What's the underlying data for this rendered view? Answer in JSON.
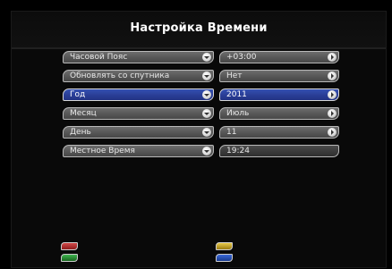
{
  "title": "Настройка Времени",
  "rows": [
    {
      "label": "Часовой Пояс",
      "value": "+03:00",
      "selected": false
    },
    {
      "label": "Обновлять со спутника",
      "value": "Нет",
      "selected": false
    },
    {
      "label": "Год",
      "value": "2011",
      "selected": true
    },
    {
      "label": "Месяц",
      "value": "Июль",
      "selected": false
    },
    {
      "label": "День",
      "value": "11",
      "selected": false
    },
    {
      "label": "Местное Время",
      "value": "19:24",
      "selected": false
    }
  ],
  "colors": {
    "selected": "#2a3e96",
    "background": "#090909"
  },
  "footer_buttons": [
    {
      "name": "red-button",
      "color": "red"
    },
    {
      "name": "green-button",
      "color": "green"
    },
    {
      "name": "yellow-button",
      "color": "yellow"
    },
    {
      "name": "blue-button",
      "color": "blue"
    }
  ]
}
